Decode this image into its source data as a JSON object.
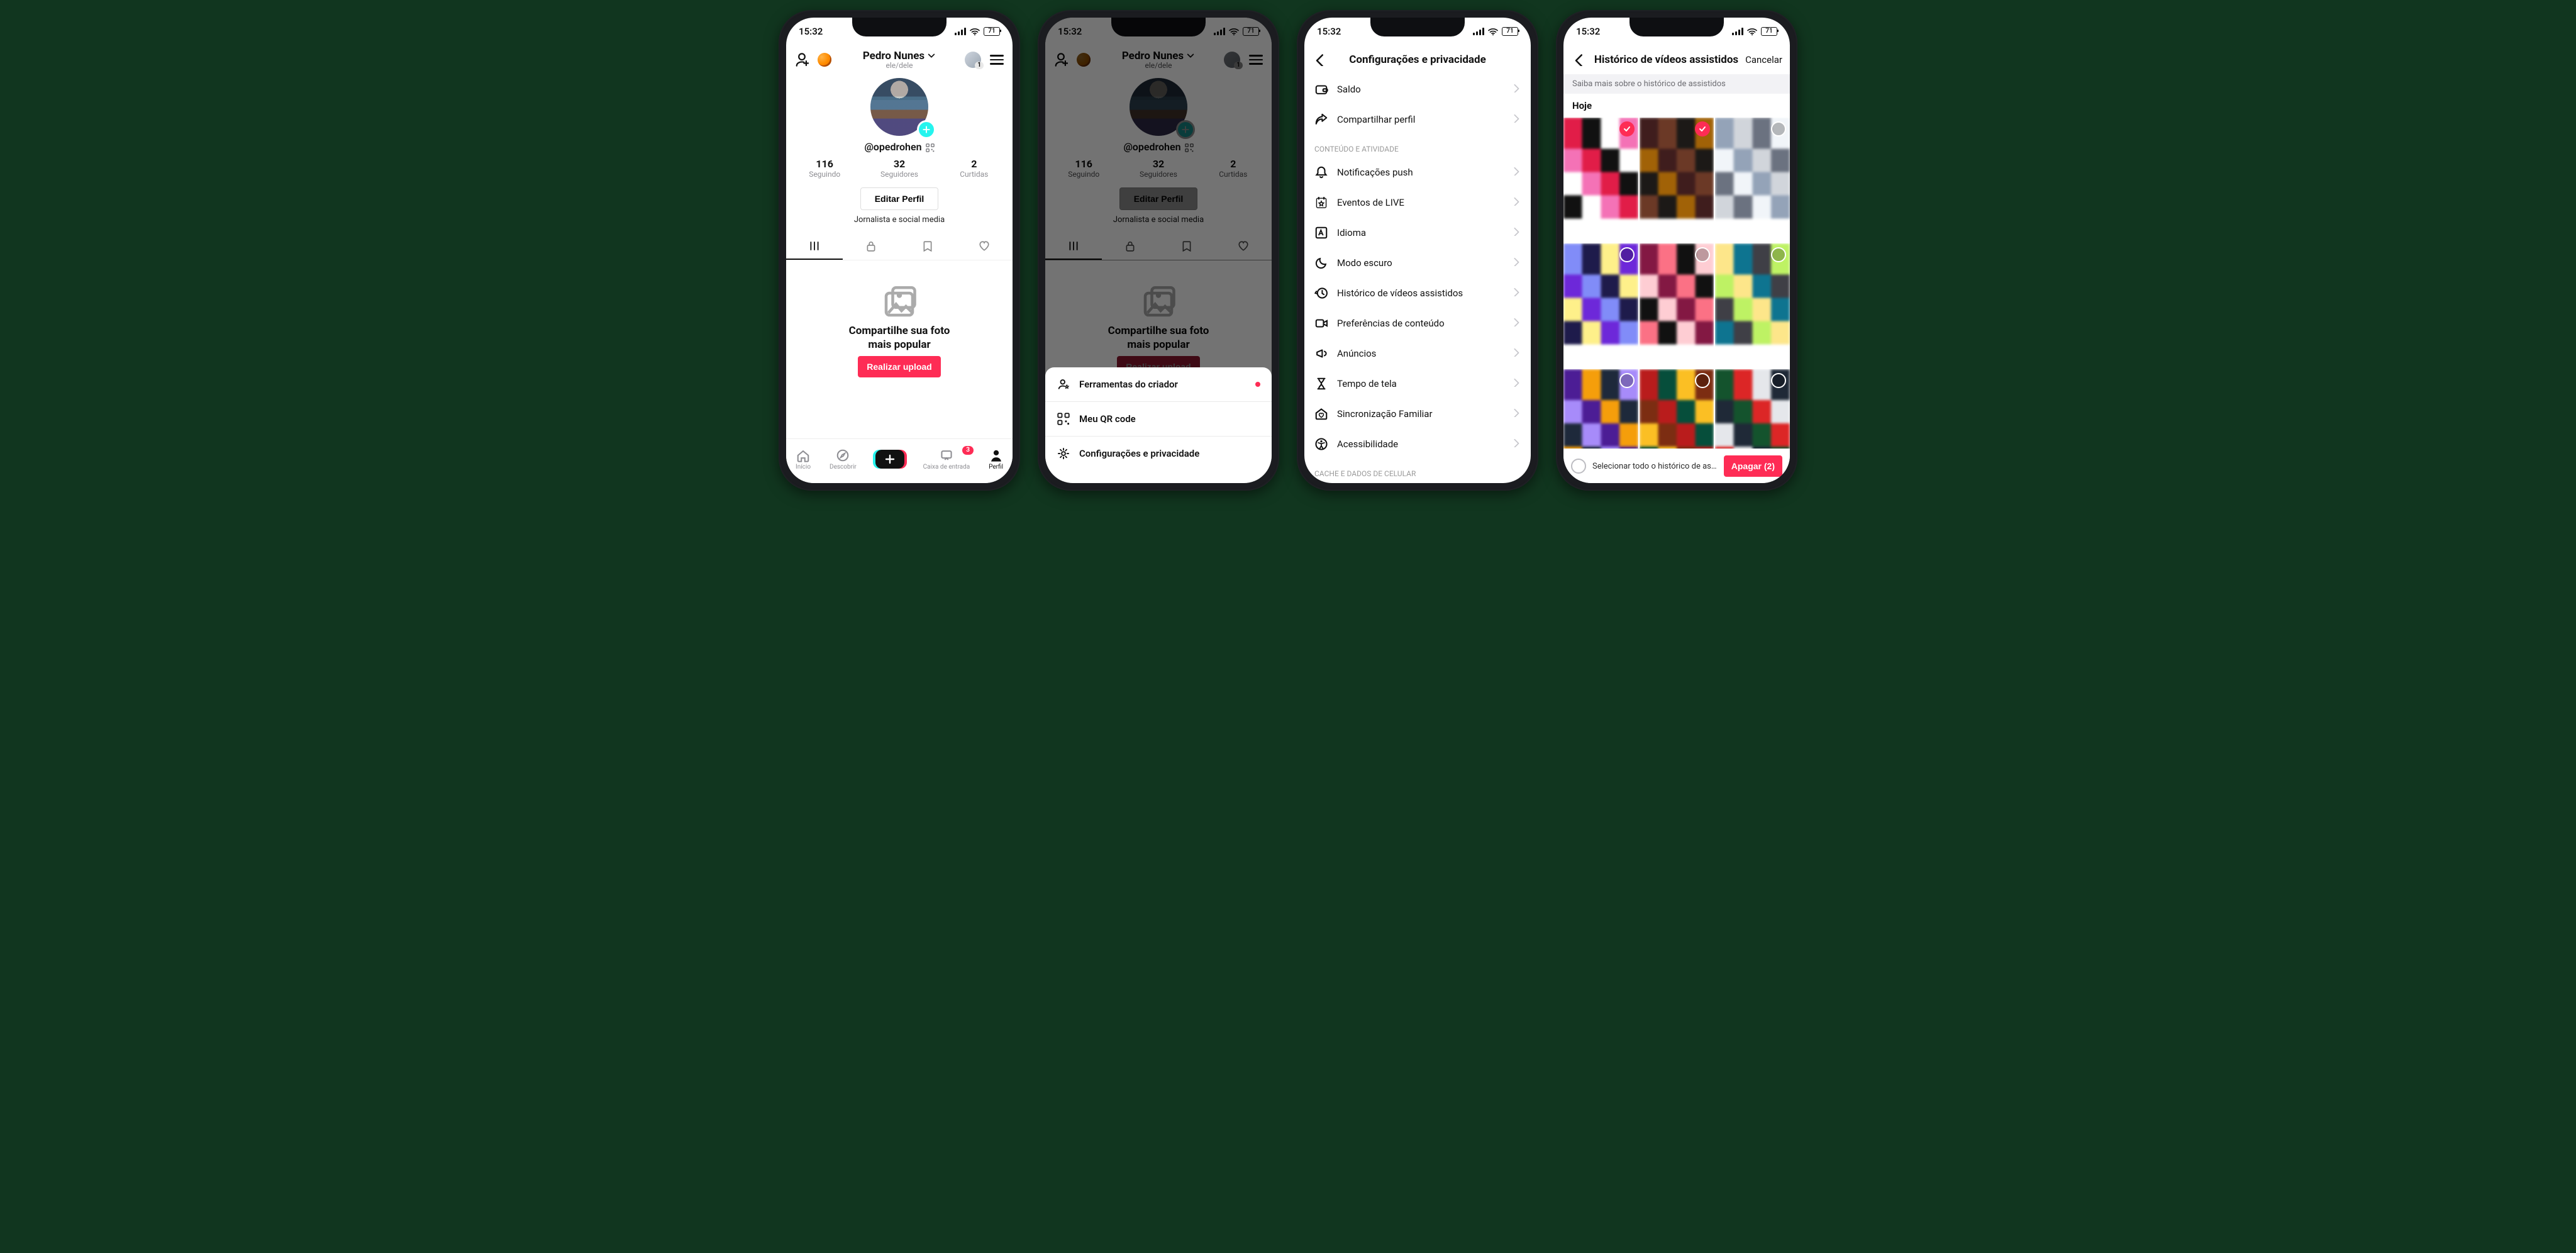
{
  "status": {
    "time": "15:32",
    "battery": "71"
  },
  "profile": {
    "name": "Pedro Nunes",
    "pronouns": "ele/dele",
    "switcher_badge": "1",
    "handle": "@opedrohen",
    "following_n": "116",
    "following_lbl": "Seguindo",
    "followers_n": "32",
    "followers_lbl": "Seguidores",
    "likes_n": "2",
    "likes_lbl": "Curtidas",
    "edit_btn": "Editar Perfil",
    "bio": "Jornalista e social media",
    "empty_line1": "Compartilhe sua foto",
    "empty_line2": "mais popular",
    "upload_btn": "Realizar upload"
  },
  "tabbar": {
    "home": "Início",
    "discover": "Descobrir",
    "inbox": "Caixa de entrada",
    "inbox_badge": "3",
    "profile": "Perfil"
  },
  "menu_sheet": {
    "creator_tools": "Ferramentas do criador",
    "qr": "Meu QR code",
    "settings": "Configurações e privacidade"
  },
  "settings": {
    "title": "Configurações e privacidade",
    "balance": "Saldo",
    "share_profile": "Compartilhar perfil",
    "section_content": "CONTEÚDO E ATIVIDADE",
    "push": "Notificações push",
    "live_events": "Eventos de LIVE",
    "language": "Idioma",
    "dark_mode": "Modo escuro",
    "watch_history": "Histórico de vídeos assistidos",
    "content_prefs": "Preferências de conteúdo",
    "ads": "Anúncios",
    "screen_time": "Tempo de tela",
    "family_pairing": "Sincronização Familiar",
    "accessibility": "Acessibilidade",
    "section_cache": "CACHE E DADOS DE CELULAR"
  },
  "watch_history": {
    "title": "Histórico de vídeos assistidos",
    "cancel": "Cancelar",
    "info": "Saiba mais sobre o histórico de assistidos",
    "today": "Hoje",
    "select_all": "Selecionar todo o histórico de assis...",
    "delete_btn": "Apagar (2)",
    "selected": [
      0,
      1
    ],
    "thumb_count": 9
  }
}
